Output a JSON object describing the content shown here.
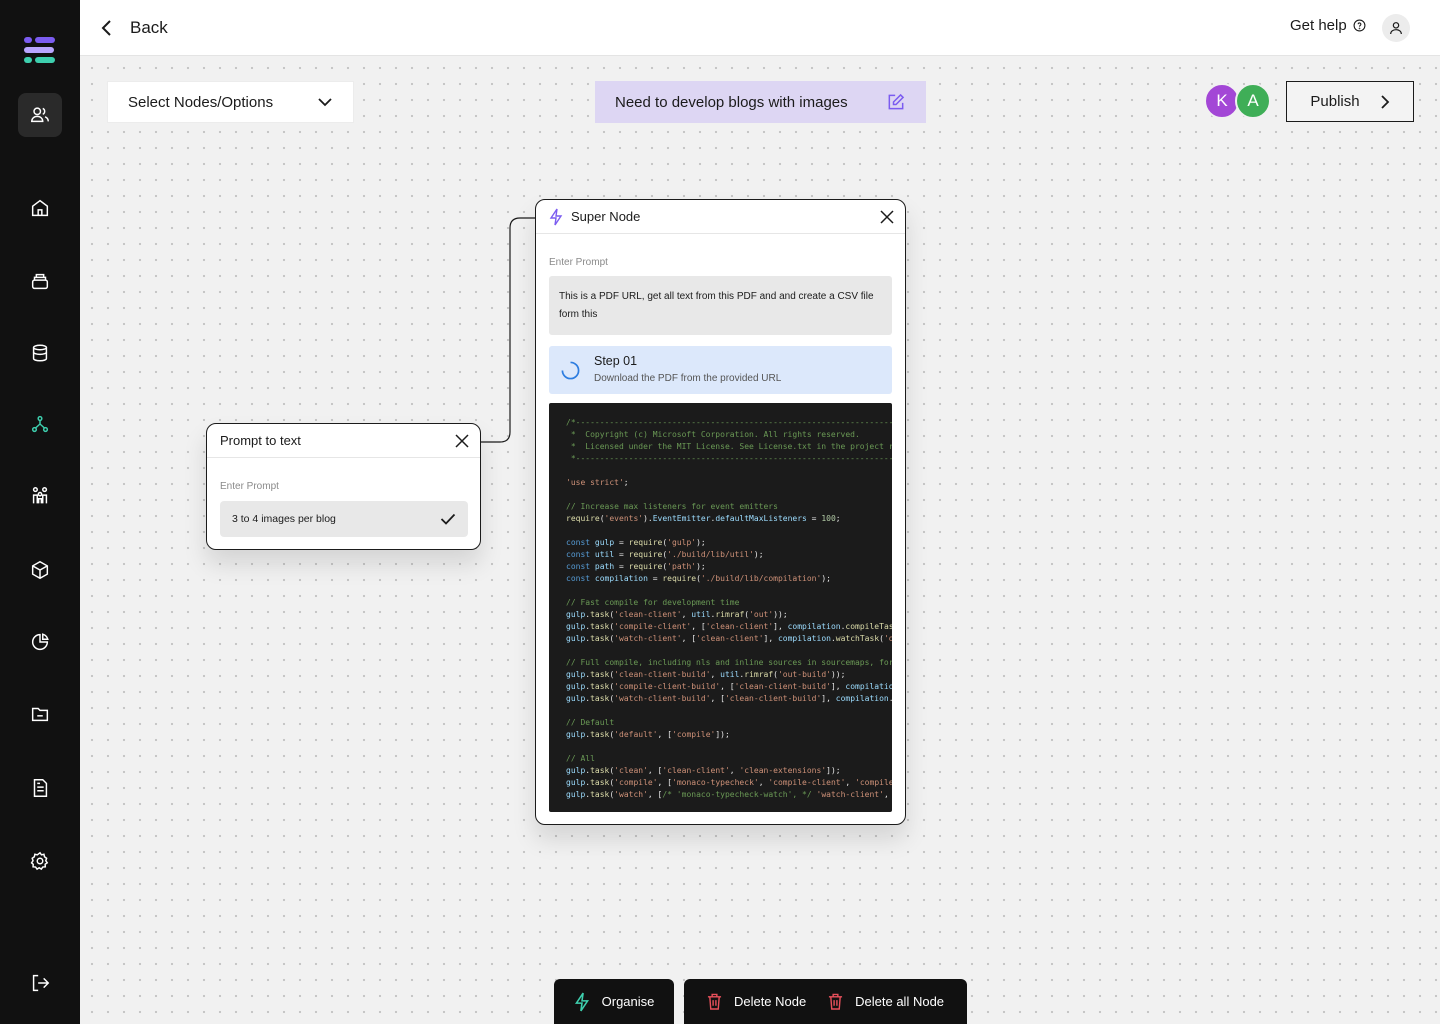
{
  "topbar": {
    "back_label": "Back",
    "help_label": "Get help"
  },
  "sidebar": {
    "items": [
      {
        "icon": "users-icon",
        "active": true
      },
      {
        "icon": "home-icon"
      },
      {
        "icon": "layers-icon"
      },
      {
        "icon": "database-icon"
      },
      {
        "icon": "workflow-icon",
        "accent": "#3ecfae"
      },
      {
        "icon": "team-icon"
      },
      {
        "icon": "cube-icon"
      },
      {
        "icon": "pie-chart-icon"
      },
      {
        "icon": "folder-icon"
      },
      {
        "icon": "document-icon"
      },
      {
        "icon": "settings-icon"
      },
      {
        "icon": "logout-icon"
      }
    ]
  },
  "canvas": {
    "select_label": "Select Nodes/Options",
    "prompt_banner": "Need to develop blogs with images",
    "avatars": [
      {
        "letter": "K",
        "color": "#a347d6"
      },
      {
        "letter": "A",
        "color": "#3fae57"
      }
    ],
    "publish_label": "Publish"
  },
  "prompt_to_text": {
    "title": "Prompt to text",
    "field_label": "Enter Prompt",
    "value": "3 to 4 images per blog"
  },
  "super_node": {
    "title": "Super Node",
    "field_label": "Enter Prompt",
    "prompt": "This is a PDF URL, get all text from this PDF and and create a CSV file form this",
    "step_title": "Step 01",
    "step_desc": "Download the PDF from the provided URL"
  },
  "toolbar": {
    "organise_label": "Organise",
    "delete_node_label": "Delete Node",
    "delete_all_label": "Delete all Node"
  },
  "colors": {
    "sidebar_bg": "#111111",
    "banner_bg": "#ddd6f3",
    "accent_purple": "#7b5cf0",
    "accent_teal": "#3ecfae",
    "delete_red": "#e8505b"
  }
}
